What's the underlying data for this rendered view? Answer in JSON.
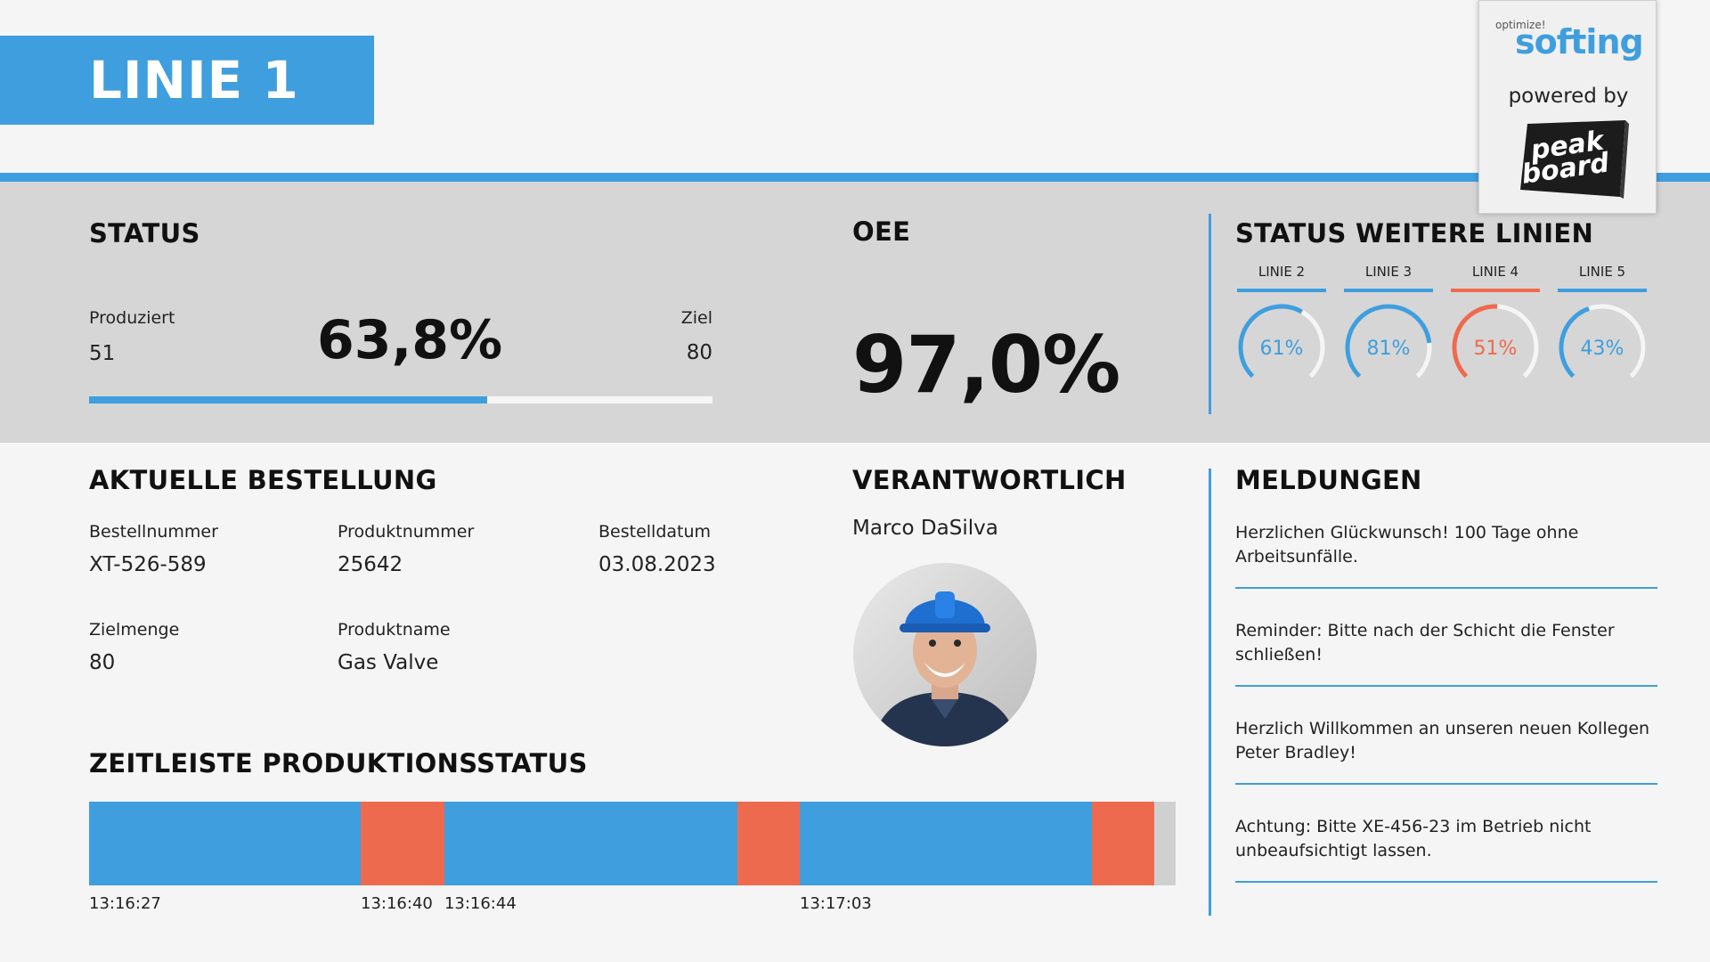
{
  "header": {
    "line_title": "LINIE 1"
  },
  "logo": {
    "optimize": "optimize!",
    "softing": "softing",
    "powered_by": "powered by",
    "peakboard": "peak board"
  },
  "status": {
    "title": "STATUS",
    "produced_label": "Produziert",
    "produced_value": "51",
    "percent": "63,8%",
    "target_label": "Ziel",
    "target_value": "80",
    "progress_fraction": 0.638
  },
  "oee": {
    "title": "OEE",
    "value": "97,0%"
  },
  "other_lines": {
    "title": "STATUS WEITERE LINIEN",
    "lines": [
      {
        "label": "LINIE 2",
        "value": "61%",
        "fraction": 0.61,
        "color": "#3f9ede"
      },
      {
        "label": "LINIE 3",
        "value": "81%",
        "fraction": 0.81,
        "color": "#3f9ede"
      },
      {
        "label": "LINIE 4",
        "value": "51%",
        "fraction": 0.51,
        "color": "#ee6a4f"
      },
      {
        "label": "LINIE 5",
        "value": "43%",
        "fraction": 0.43,
        "color": "#3f9ede"
      }
    ]
  },
  "order": {
    "title": "AKTUELLE BESTELLUNG",
    "order_number_label": "Bestellnummer",
    "order_number": "XT-526-589",
    "product_number_label": "Produktnummer",
    "product_number": "25642",
    "order_date_label": "Bestelldatum",
    "order_date": "03.08.2023",
    "target_qty_label": "Zielmenge",
    "target_qty": "80",
    "product_name_label": "Produktname",
    "product_name": "Gas Valve"
  },
  "responsible": {
    "title": "VERANTWORTLICH",
    "name": "Marco DaSilva"
  },
  "messages": {
    "title": "MELDUNGEN",
    "items": [
      "Herzlichen Glückwunsch! 100 Tage ohne Arbeitsunfälle.",
      "Reminder: Bitte nach der Schicht die Fenster schließen!",
      "Herzlich Willkommen an unseren neuen Kollegen Peter Bradley!",
      "Achtung: Bitte XE-456-23 im Betrieb nicht unbeaufsichtigt lassen."
    ]
  },
  "timeline": {
    "title": "ZEITLEISTE PRODUKTIONSSTATUS",
    "colors": {
      "running": "#3f9ede",
      "stopped": "#ee6a4f",
      "remaining": "#d0d0d0"
    },
    "segments": [
      {
        "state": "running",
        "fraction": 0.25
      },
      {
        "state": "stopped",
        "fraction": 0.077
      },
      {
        "state": "running",
        "fraction": 0.27
      },
      {
        "state": "stopped",
        "fraction": 0.057
      },
      {
        "state": "running",
        "fraction": 0.269
      },
      {
        "state": "stopped",
        "fraction": 0.057
      }
    ],
    "times": [
      {
        "label": "13:16:27",
        "fraction": 0.0
      },
      {
        "label": "13:16:40",
        "fraction": 0.25
      },
      {
        "label": "13:16:44",
        "fraction": 0.327
      },
      {
        "label": "13:17:03",
        "fraction": 0.654
      }
    ]
  }
}
